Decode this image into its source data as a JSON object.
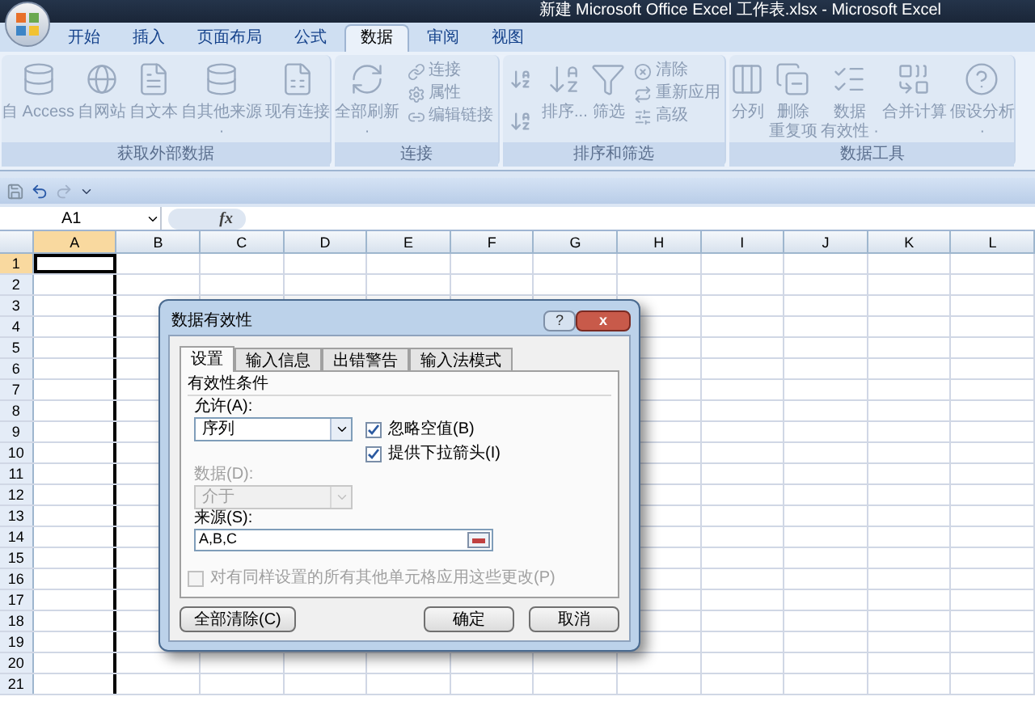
{
  "window": {
    "title": "新建 Microsoft Office Excel 工作表.xlsx - Microsoft Excel"
  },
  "tabs": [
    {
      "label": "开始",
      "selected": false
    },
    {
      "label": "插入",
      "selected": false
    },
    {
      "label": "页面布局",
      "selected": false
    },
    {
      "label": "公式",
      "selected": false
    },
    {
      "label": "数据",
      "selected": true
    },
    {
      "label": "审阅",
      "selected": false
    },
    {
      "label": "视图",
      "selected": false
    }
  ],
  "ribbon": [
    {
      "label": "获取外部数据",
      "items": [
        {
          "kind": "large",
          "lines": [
            "自 Access"
          ]
        },
        {
          "kind": "large",
          "lines": [
            "自网站"
          ]
        },
        {
          "kind": "large",
          "lines": [
            "自文本"
          ]
        },
        {
          "kind": "large",
          "lines": [
            "自其他来源",
            "·"
          ]
        },
        {
          "kind": "large",
          "lines": [
            "现有连接"
          ]
        }
      ]
    },
    {
      "label": "连接",
      "items": [
        {
          "kind": "large",
          "lines": [
            "全部刷新",
            "·"
          ]
        },
        {
          "kind": "small",
          "lines": [
            "连接"
          ]
        },
        {
          "kind": "small",
          "lines": [
            "属性"
          ]
        },
        {
          "kind": "small",
          "lines": [
            "编辑链接"
          ]
        }
      ]
    },
    {
      "label": "排序和筛选",
      "items": [
        {
          "kind": "sort"
        },
        {
          "kind": "large",
          "lines": [
            "排序..."
          ]
        },
        {
          "kind": "large",
          "lines": [
            "筛选"
          ]
        },
        {
          "kind": "small",
          "lines": [
            "清除"
          ]
        },
        {
          "kind": "small",
          "lines": [
            "重新应用"
          ]
        },
        {
          "kind": "small",
          "lines": [
            "高级"
          ]
        }
      ]
    },
    {
      "label": "数据工具",
      "items": [
        {
          "kind": "large",
          "lines": [
            "分列"
          ]
        },
        {
          "kind": "large",
          "lines": [
            "删除",
            "重复项"
          ]
        },
        {
          "kind": "large",
          "lines": [
            "数据",
            "有效性 ·"
          ]
        },
        {
          "kind": "large",
          "lines": [
            "合并计算"
          ]
        },
        {
          "kind": "large",
          "lines": [
            "假设分析",
            "·"
          ]
        }
      ]
    }
  ],
  "name_box": "A1",
  "formula_label": "fx",
  "columns": [
    {
      "label": "A",
      "selected": true
    },
    {
      "label": "B",
      "selected": false
    },
    {
      "label": "C",
      "selected": false
    },
    {
      "label": "D",
      "selected": false
    },
    {
      "label": "E",
      "selected": false
    },
    {
      "label": "F",
      "selected": false
    },
    {
      "label": "G",
      "selected": false
    },
    {
      "label": "H",
      "selected": false
    },
    {
      "label": "I",
      "selected": false
    },
    {
      "label": "J",
      "selected": false
    },
    {
      "label": "K",
      "selected": false
    },
    {
      "label": "L",
      "selected": false
    }
  ],
  "rows": [
    {
      "label": "1",
      "selected": true
    },
    {
      "label": "2",
      "selected": false
    },
    {
      "label": "3",
      "selected": false
    },
    {
      "label": "4",
      "selected": false
    },
    {
      "label": "5",
      "selected": false
    },
    {
      "label": "6",
      "selected": false
    },
    {
      "label": "7",
      "selected": false
    },
    {
      "label": "8",
      "selected": false
    },
    {
      "label": "9",
      "selected": false
    },
    {
      "label": "10",
      "selected": false
    },
    {
      "label": "11",
      "selected": false
    },
    {
      "label": "12",
      "selected": false
    },
    {
      "label": "13",
      "selected": false
    },
    {
      "label": "14",
      "selected": false
    },
    {
      "label": "15",
      "selected": false
    },
    {
      "label": "16",
      "selected": false
    },
    {
      "label": "17",
      "selected": false
    },
    {
      "label": "18",
      "selected": false
    },
    {
      "label": "19",
      "selected": false
    },
    {
      "label": "20",
      "selected": false
    },
    {
      "label": "21",
      "selected": false
    }
  ],
  "dialog": {
    "title": "数据有效性",
    "help": "?",
    "close": "x",
    "tabs": [
      {
        "label": "设置",
        "selected": true
      },
      {
        "label": "输入信息",
        "selected": false
      },
      {
        "label": "出错警告",
        "selected": false
      },
      {
        "label": "输入法模式",
        "selected": false
      }
    ],
    "section": "有效性条件",
    "allow": {
      "label": "允许(A):",
      "value": "序列",
      "disabled": false
    },
    "data": {
      "label": "数据(D):",
      "value": "介于",
      "disabled": true
    },
    "options": [
      {
        "label": "忽略空值(B)",
        "checked": true
      },
      {
        "label": "提供下拉箭头(I)",
        "checked": true
      }
    ],
    "source": {
      "label": "来源(S):",
      "value": "A,B,C"
    },
    "apply_all": {
      "label": "对有同样设置的所有其他单元格应用这些更改(P)",
      "checked": false,
      "disabled": true
    },
    "buttons": [
      {
        "label": "全部清除(C)",
        "kind": "left"
      },
      {
        "label": "确定",
        "kind": "right"
      },
      {
        "label": "取消",
        "kind": "right"
      }
    ]
  }
}
